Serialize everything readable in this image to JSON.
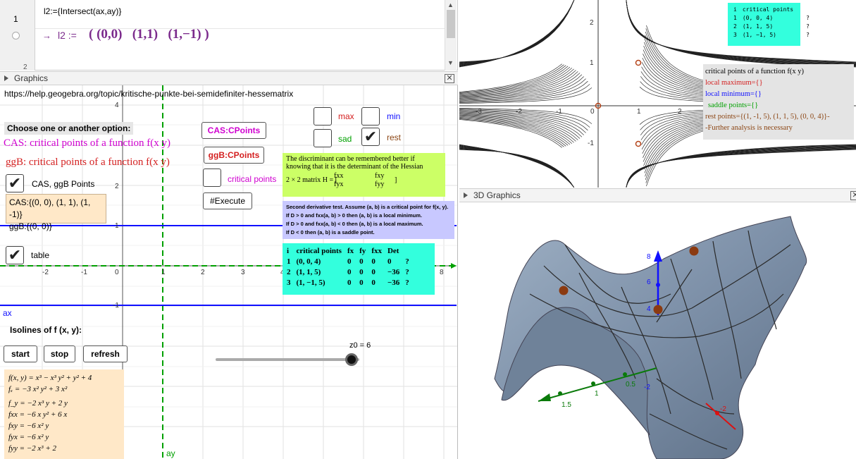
{
  "cas": {
    "row1_number": "1",
    "row1_input": "l2:={Intersect(ax,ay)}",
    "row1_arrow": "→",
    "row1_output_name": "l2 :=",
    "row1_output_value": "( (0,0)   (1,1)   (1,−1) )",
    "row2_number": "2"
  },
  "graphics": {
    "header_title": "Graphics",
    "url_text": "https://help.geogebra.org/topic/kritische-punkte-bei-semidefiniter-hessematrix",
    "option_title": "Choose one or another option:",
    "cas_title": "CAS: critical points of a function f(x y)",
    "ggb_title": "ggB: critical points of a function f(x y)",
    "cas_ggb_points_label": "CAS, ggB Points",
    "cas_result": "CAS:{(0, 0), (1, 1), (1, -1)}",
    "ggb_result": "ggB:{(0, 0)}",
    "table_label": "table",
    "isolines_title": "Isolines of f (x, y):",
    "start_label": "start",
    "stop_label": "stop",
    "refresh_label": "refresh",
    "cas_button": "CAS:CPoints",
    "ggb_button": "ggB:CPoints",
    "critical_points_label": "critical points",
    "execute_button": "#Execute",
    "max_label": "max",
    "min_label": "min",
    "sad_label": "sad",
    "rest_label": "rest",
    "slider_label": "z0 = 6",
    "slider_value_fraction": 0.96,
    "ax_label": "ax",
    "ay_label": "ay",
    "x_ticks": [
      "-2",
      "-1",
      "0",
      "1",
      "2",
      "3",
      "4",
      "8"
    ],
    "y_ticks": [
      "4",
      "2",
      "1",
      "-1"
    ],
    "hessian_note_line1": "The discriminant can be remembered better if",
    "hessian_note_line2": "knowing that it is the determinant of the Hessian",
    "hessian_note_line3": "2 × 2 matrix H = [",
    "hessian_fxx": "fxx",
    "hessian_fxy": "fxy",
    "hessian_fyx": "fyx",
    "hessian_fyy": "fyy",
    "hessian_close": "]",
    "second_deriv_line1": "Second derivative test. Assume (a, b) is a critical point for f(x, y).",
    "second_deriv_line2": "If D > 0 and fxx(a, b) > 0 then (a, b) is a local minimum.",
    "second_deriv_line3": "If D > 0 and fxx(a, b) < 0 then (a, b) is a local maximum.",
    "second_deriv_line4": "If D < 0 then (a, b) is a saddle point.",
    "table": {
      "headers": [
        "i",
        "critical points",
        "fx",
        "fy",
        "fxx",
        "Det",
        ""
      ],
      "rows": [
        [
          "1",
          "(0, 0, 4)",
          "0",
          "0",
          "0",
          "0",
          "?"
        ],
        [
          "2",
          "(1, 1, 5)",
          "0",
          "0",
          "0",
          "−36",
          "?"
        ],
        [
          "3",
          "(1, −1, 5)",
          "0",
          "0",
          "0",
          "−36",
          "?"
        ]
      ]
    },
    "formulas": [
      "f(x, y) = x³ − x³ y² + y² + 4",
      "fₓ = −3 x² y² + 3 x²",
      "f_y = −2 x³ y + 2 y",
      "fxx = −6 x y² + 6 x",
      "fxy = −6 x² y",
      "fyx = −6 x² y",
      "fyy = −2 x³ + 2"
    ]
  },
  "graphics2": {
    "mini_table_header": [
      "i",
      "critical points",
      ""
    ],
    "mini_table_rows": [
      [
        "1",
        "(0, 0, 4)",
        "?"
      ],
      [
        "2",
        "(1, 1, 5)",
        "?"
      ],
      [
        "3",
        "(1, −1, 5)",
        "?"
      ]
    ],
    "info_title": "critical points of a function f(x y)",
    "info_max": "local maximum={}",
    "info_min": "local minimum={}",
    "info_saddle": "saddle points={}",
    "info_rest": "rest points={(1, -1, 5), (1, 1, 5), (0, 0, 4)}-",
    "info_further": "-Further analysis is necessary",
    "x_ticks": [
      "-3",
      "-2",
      "-1",
      "0",
      "1",
      "2"
    ],
    "y_ticks": [
      "2",
      "1",
      "-1"
    ]
  },
  "view3d": {
    "header_title": "3D Graphics",
    "axis_labels": [
      "8",
      "6",
      "4",
      "1.5",
      "1",
      "0.5",
      "-2",
      "-2"
    ]
  },
  "colors": {
    "cas_purple": "#7b2a8c",
    "magenta": "#d000d0",
    "red": "#d42020",
    "blue": "#1010ff",
    "green": "#00a000",
    "brown": "#8b4513",
    "cyan_box": "#33ffdd",
    "yellow_green_box": "#ccff66",
    "lavender_box": "#c8c8ff",
    "peach_box": "#ffe8c8",
    "surface": "#8497ad"
  }
}
